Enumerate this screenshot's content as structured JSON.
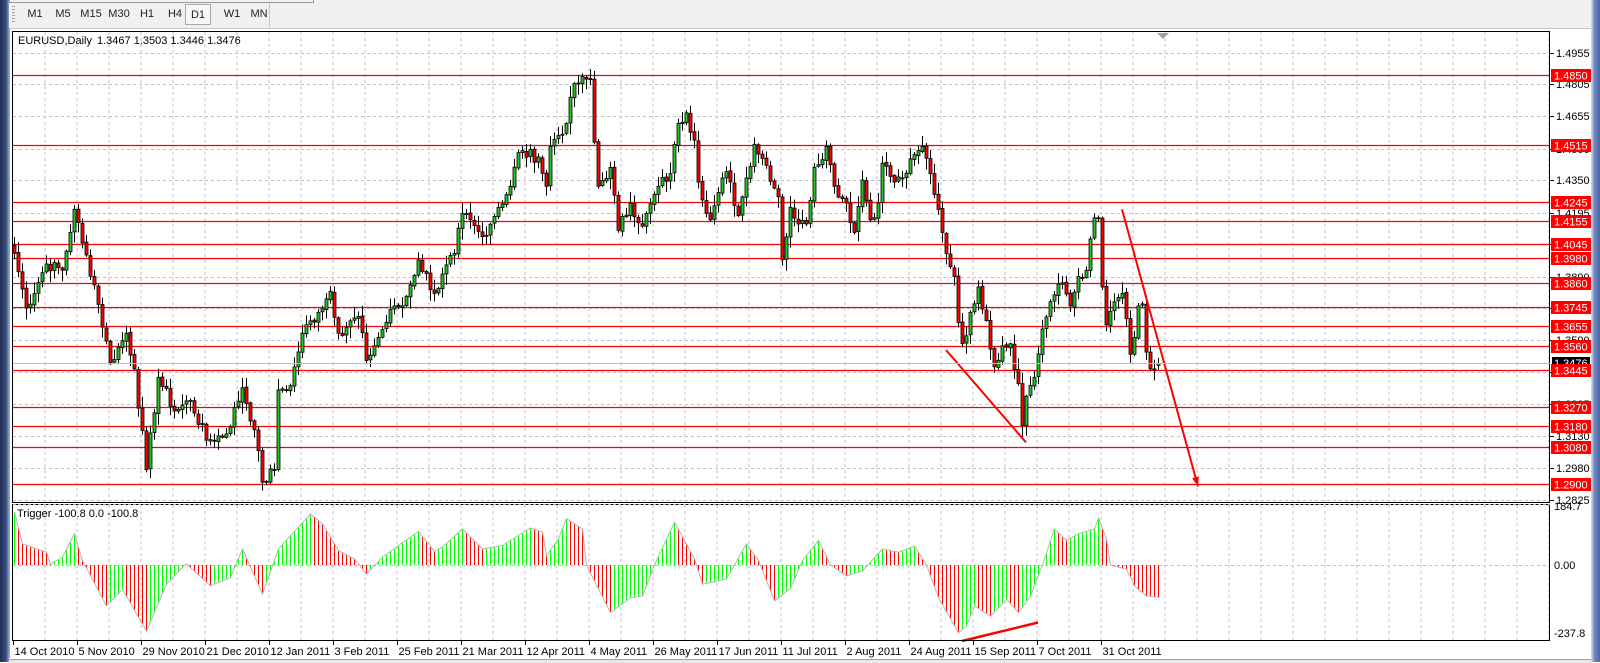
{
  "toolbar": {
    "timeframes": [
      "M1",
      "M5",
      "M15",
      "M30",
      "H1",
      "H4",
      "D1",
      "W1",
      "MN"
    ],
    "active": "D1"
  },
  "chart_header": {
    "symbol_period": "EURUSD,Daily",
    "ohlc": "1.3467 1.3503 1.3446 1.3476"
  },
  "indicator_header": "Trigger -100.8 0.0 -100.8",
  "colors": {
    "bull_body": "#22c322",
    "bear_body": "#ff0000",
    "level_line": "#ff0000",
    "hist_up": "#00ff00",
    "hist_down": "#ff0000",
    "hist_line": "#b4b4b4",
    "grid": "#c0c0c0"
  },
  "chart_data": [
    {
      "type": "candlestick",
      "title": "EURUSD,Daily",
      "last_bar": {
        "open": 1.3467,
        "high": 1.3503,
        "low": 1.3446,
        "close": 1.3476
      },
      "current_price_label": "1.3476",
      "ylim": [
        1.2825,
        1.4955
      ],
      "y_ticks": [
        "1.4955",
        "1.4805",
        "1.4655",
        "1.4500",
        "1.4350",
        "1.4195",
        "1.4045",
        "1.3890",
        "1.3740",
        "1.3590",
        "1.3435",
        "1.3285",
        "1.3130",
        "1.2980",
        "1.2825"
      ],
      "x_tick_labels": [
        "14 Oct 2010",
        "5 Nov 2010",
        "29 Nov 2010",
        "21 Dec 2010",
        "12 Jan 2011",
        "3 Feb 2011",
        "25 Feb 2011",
        "21 Mar 2011",
        "12 Apr 2011",
        "4 May 2011",
        "26 May 2011",
        "17 Jun 2011",
        "11 Jul 2011",
        "2 Aug 2011",
        "24 Aug 2011",
        "15 Sep 2011",
        "7 Oct 2011",
        "31 Oct 2011"
      ],
      "bars_per_x_tick": 16,
      "bar_count": 287,
      "close_keypoints": [
        [
          0,
          1.4
        ],
        [
          3,
          1.374
        ],
        [
          8,
          1.395
        ],
        [
          12,
          1.392
        ],
        [
          15,
          1.421
        ],
        [
          17,
          1.405
        ],
        [
          20,
          1.385
        ],
        [
          24,
          1.348
        ],
        [
          28,
          1.362
        ],
        [
          30,
          1.345
        ],
        [
          33,
          1.297
        ],
        [
          36,
          1.341
        ],
        [
          40,
          1.325
        ],
        [
          44,
          1.33
        ],
        [
          48,
          1.311
        ],
        [
          53,
          1.314
        ],
        [
          57,
          1.336
        ],
        [
          60,
          1.316
        ],
        [
          62,
          1.291
        ],
        [
          65,
          1.297
        ],
        [
          66,
          1.335
        ],
        [
          69,
          1.337
        ],
        [
          72,
          1.362
        ],
        [
          76,
          1.372
        ],
        [
          79,
          1.382
        ],
        [
          81,
          1.362
        ],
        [
          86,
          1.37
        ],
        [
          88,
          1.349
        ],
        [
          91,
          1.36
        ],
        [
          95,
          1.375
        ],
        [
          97,
          1.375
        ],
        [
          99,
          1.385
        ],
        [
          101,
          1.397
        ],
        [
          105,
          1.381
        ],
        [
          110,
          1.4
        ],
        [
          112,
          1.419
        ],
        [
          117,
          1.408
        ],
        [
          121,
          1.422
        ],
        [
          124,
          1.432
        ],
        [
          126,
          1.448
        ],
        [
          131,
          1.446
        ],
        [
          133,
          1.432
        ],
        [
          134,
          1.451
        ],
        [
          138,
          1.462
        ],
        [
          140,
          1.481
        ],
        [
          144,
          1.483
        ],
        [
          145,
          1.453
        ],
        [
          146,
          1.432
        ],
        [
          149,
          1.441
        ],
        [
          151,
          1.411
        ],
        [
          154,
          1.424
        ],
        [
          157,
          1.413
        ],
        [
          161,
          1.432
        ],
        [
          164,
          1.438
        ],
        [
          166,
          1.462
        ],
        [
          168,
          1.467
        ],
        [
          170,
          1.454
        ],
        [
          171,
          1.434
        ],
        [
          174,
          1.416
        ],
        [
          176,
          1.429
        ],
        [
          178,
          1.439
        ],
        [
          181,
          1.418
        ],
        [
          183,
          1.436
        ],
        [
          185,
          1.452
        ],
        [
          188,
          1.442
        ],
        [
          191,
          1.427
        ],
        [
          192,
          1.397
        ],
        [
          194,
          1.422
        ],
        [
          196,
          1.414
        ],
        [
          198,
          1.414
        ],
        [
          200,
          1.441
        ],
        [
          203,
          1.451
        ],
        [
          205,
          1.432
        ],
        [
          208,
          1.424
        ],
        [
          210,
          1.41
        ],
        [
          212,
          1.435
        ],
        [
          214,
          1.416
        ],
        [
          216,
          1.424
        ],
        [
          217,
          1.443
        ],
        [
          220,
          1.434
        ],
        [
          222,
          1.436
        ],
        [
          226,
          1.449
        ],
        [
          227,
          1.451
        ],
        [
          229,
          1.438
        ],
        [
          231,
          1.421
        ],
        [
          232,
          1.41
        ],
        [
          233,
          1.4
        ],
        [
          235,
          1.389
        ],
        [
          236,
          1.367
        ],
        [
          237,
          1.357
        ],
        [
          240,
          1.376
        ],
        [
          241,
          1.384
        ],
        [
          243,
          1.368
        ],
        [
          245,
          1.346
        ],
        [
          247,
          1.356
        ],
        [
          249,
          1.357
        ],
        [
          251,
          1.338
        ],
        [
          252,
          1.318
        ],
        [
          253,
          1.332
        ],
        [
          255,
          1.341
        ],
        [
          257,
          1.364
        ],
        [
          259,
          1.377
        ],
        [
          262,
          1.386
        ],
        [
          264,
          1.375
        ],
        [
          266,
          1.389
        ],
        [
          268,
          1.392
        ],
        [
          270,
          1.417
        ],
        [
          271,
          1.417
        ],
        [
          272,
          1.384
        ],
        [
          273,
          1.366
        ],
        [
          275,
          1.377
        ],
        [
          277,
          1.381
        ],
        [
          279,
          1.352
        ],
        [
          280,
          1.36
        ],
        [
          281,
          1.375
        ],
        [
          282,
          1.376
        ],
        [
          283,
          1.353
        ],
        [
          284,
          1.345
        ],
        [
          285,
          1.345
        ],
        [
          286,
          1.3476
        ]
      ],
      "horizontal_levels": [
        "1.4850",
        "1.4515",
        "1.4245",
        "1.4155",
        "1.4045",
        "1.3980",
        "1.3860",
        "1.3745",
        "1.3655",
        "1.3560",
        "1.3445",
        "1.3270",
        "1.3180",
        "1.3080",
        "1.2900"
      ],
      "trendlines": [
        {
          "name": "divergence-line",
          "from": [
            233,
            1.354
          ],
          "to": [
            253,
            1.31
          ],
          "arrow": false
        },
        {
          "name": "down-arrow",
          "from": [
            277,
            1.421
          ],
          "to": [
            296,
            1.289
          ],
          "arrow": true
        }
      ]
    },
    {
      "type": "histogram",
      "title": "Trigger",
      "values_label": "Trigger -100.8 0.0 -100.8",
      "ylim": [
        -237.8,
        184.7
      ],
      "y_ticks": [
        "184.7",
        "0.00",
        "-237.8"
      ],
      "keypoints": [
        [
          0,
          166
        ],
        [
          2,
          66
        ],
        [
          8,
          40
        ],
        [
          9,
          3
        ],
        [
          12,
          24
        ],
        [
          15,
          98
        ],
        [
          17,
          14
        ],
        [
          23,
          -128
        ],
        [
          27,
          -76
        ],
        [
          33,
          -207
        ],
        [
          38,
          -60
        ],
        [
          42,
          -7
        ],
        [
          43,
          3
        ],
        [
          49,
          -65
        ],
        [
          54,
          -39
        ],
        [
          57,
          50
        ],
        [
          62,
          -91
        ],
        [
          66,
          50
        ],
        [
          74,
          160
        ],
        [
          77,
          129
        ],
        [
          81,
          45
        ],
        [
          85,
          19
        ],
        [
          88,
          -28
        ],
        [
          92,
          24
        ],
        [
          96,
          61
        ],
        [
          101,
          105
        ],
        [
          105,
          42
        ],
        [
          107,
          56
        ],
        [
          112,
          113
        ],
        [
          117,
          50
        ],
        [
          122,
          61
        ],
        [
          129,
          116
        ],
        [
          132,
          103
        ],
        [
          133,
          29
        ],
        [
          136,
          82
        ],
        [
          138,
          145
        ],
        [
          142,
          113
        ],
        [
          143,
          0
        ],
        [
          149,
          -149
        ],
        [
          154,
          -102
        ],
        [
          157,
          -97
        ],
        [
          160,
          0
        ],
        [
          165,
          134
        ],
        [
          170,
          19
        ],
        [
          172,
          -60
        ],
        [
          178,
          -44
        ],
        [
          183,
          66
        ],
        [
          186,
          14
        ],
        [
          190,
          -112
        ],
        [
          194,
          -73
        ],
        [
          197,
          14
        ],
        [
          201,
          77
        ],
        [
          204,
          0
        ],
        [
          208,
          -34
        ],
        [
          212,
          -18
        ],
        [
          217,
          50
        ],
        [
          221,
          40
        ],
        [
          225,
          59
        ],
        [
          228,
          0
        ],
        [
          231,
          -102
        ],
        [
          236,
          -212
        ],
        [
          238,
          -191
        ],
        [
          240,
          -128
        ],
        [
          244,
          -160
        ],
        [
          248,
          -107
        ],
        [
          251,
          -149
        ],
        [
          254,
          -97
        ],
        [
          257,
          0
        ],
        [
          260,
          113
        ],
        [
          263,
          77
        ],
        [
          266,
          98
        ],
        [
          270,
          113
        ],
        [
          271,
          147
        ],
        [
          273,
          82
        ],
        [
          274,
          0
        ],
        [
          278,
          -13
        ],
        [
          280,
          -65
        ],
        [
          283,
          -97
        ],
        [
          286,
          -100.8
        ]
      ],
      "trendline": {
        "from": [
          237,
          -240
        ],
        "to": [
          256,
          -180
        ]
      }
    }
  ]
}
